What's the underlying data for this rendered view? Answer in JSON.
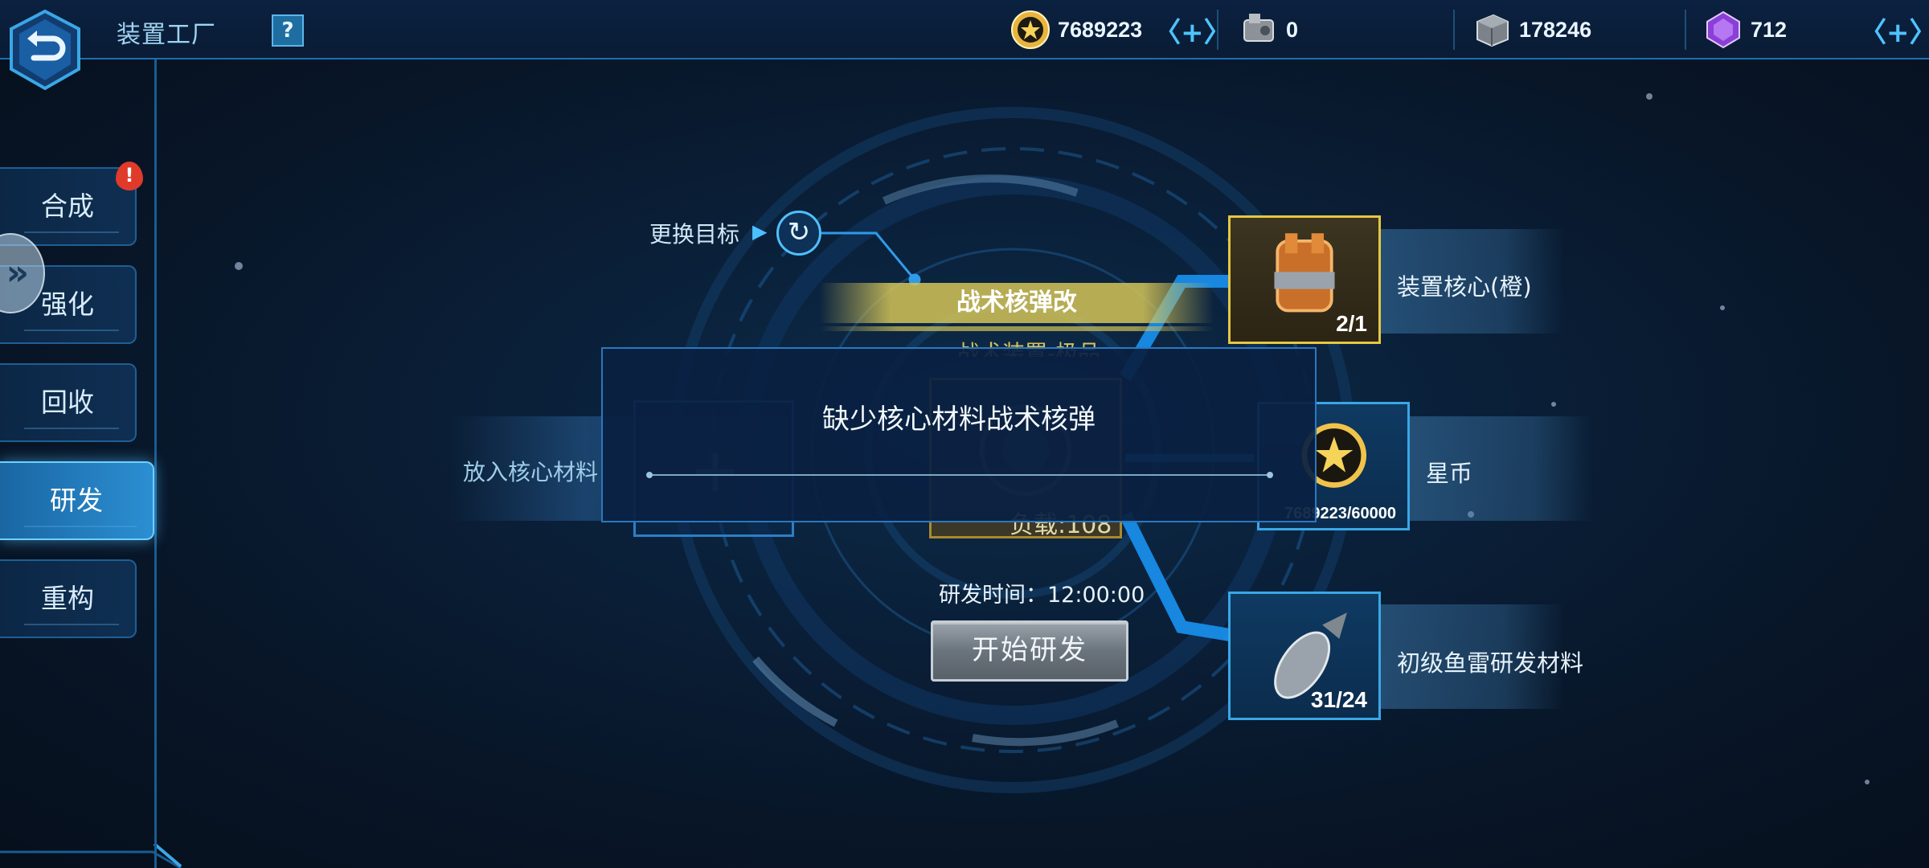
{
  "header": {
    "title": "装置工厂",
    "help_label": "?",
    "resources": [
      {
        "name": "star-coin",
        "value": "7689223",
        "plus": "〈+〉"
      },
      {
        "name": "device-parts",
        "value": "0"
      },
      {
        "name": "alloy-block",
        "value": "178246"
      },
      {
        "name": "purple-crystal",
        "value": "712",
        "plus": "〈+〉"
      }
    ]
  },
  "tabs": [
    {
      "label": "合成"
    },
    {
      "label": "强化"
    },
    {
      "label": "回收"
    },
    {
      "label": "研发",
      "active": true
    },
    {
      "label": "重构"
    }
  ],
  "badge": "!",
  "side_arrow": "»",
  "research": {
    "change_target": "更换目标",
    "change_arrow": "▶",
    "refresh_icon": "↻",
    "item_name": "战术核弹改",
    "sub_name": "战术装置-极品",
    "put_core_label": "放入核心材料",
    "slot_plus": "+",
    "load_text": "负载:108",
    "research_time": "研发时间：12:00:00",
    "start_button": "开始研发"
  },
  "materials": [
    {
      "name": "装置核心(橙)",
      "count": "2/1",
      "rarity": "orange"
    },
    {
      "name": "星币",
      "count": "7689223/60000",
      "rarity": "blue"
    },
    {
      "name": "初级鱼雷研发材料",
      "count": "31/24",
      "rarity": "blue"
    }
  ],
  "popup": {
    "message": "缺少核心材料战术核弹"
  },
  "colors": {
    "accent": "#2ea8ff",
    "gold": "#d4c458",
    "panel": "#0a2042"
  }
}
